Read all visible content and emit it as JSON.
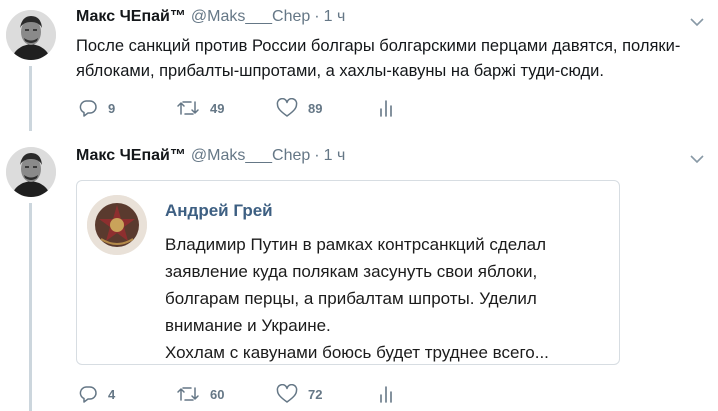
{
  "tweets": [
    {
      "author_name": "Макс ЧЕпай™",
      "handle": "@Maks___Chep",
      "separator": "·",
      "time": "1 ч",
      "text": "После санкций против России болгары болгарскими перцами давятся, поляки-яблоками, прибалты-шпротами, а хахлы-кавуны на баржі туди-сюди.",
      "reply_count": "9",
      "retweet_count": "49",
      "like_count": "89"
    },
    {
      "author_name": "Макс ЧЕпай™",
      "handle": "@Maks___Chep",
      "separator": "·",
      "time": "1 ч",
      "quote": {
        "author_name": "Андрей Грей",
        "lines": [
          "Владимир Путин в рамках контрсанкций сделал",
          "заявление куда полякам засунуть свои яблоки,",
          "болгарам перцы, а прибалтам шпроты. Уделил",
          "внимание и Украине.",
          "Хохлам с кавунами боюсь будет труднее всего..."
        ]
      },
      "reply_count": "4",
      "retweet_count": "60",
      "like_count": "72"
    }
  ],
  "icons": {
    "reply": "reply-icon",
    "retweet": "retweet-icon",
    "like": "heart-icon",
    "stats": "analytics-icon",
    "menu": "chevron-down-icon"
  },
  "colors": {
    "text": "#14171a",
    "secondary": "#657786",
    "thread_line": "#ccd6dd",
    "quote_name": "#3d5f82"
  }
}
